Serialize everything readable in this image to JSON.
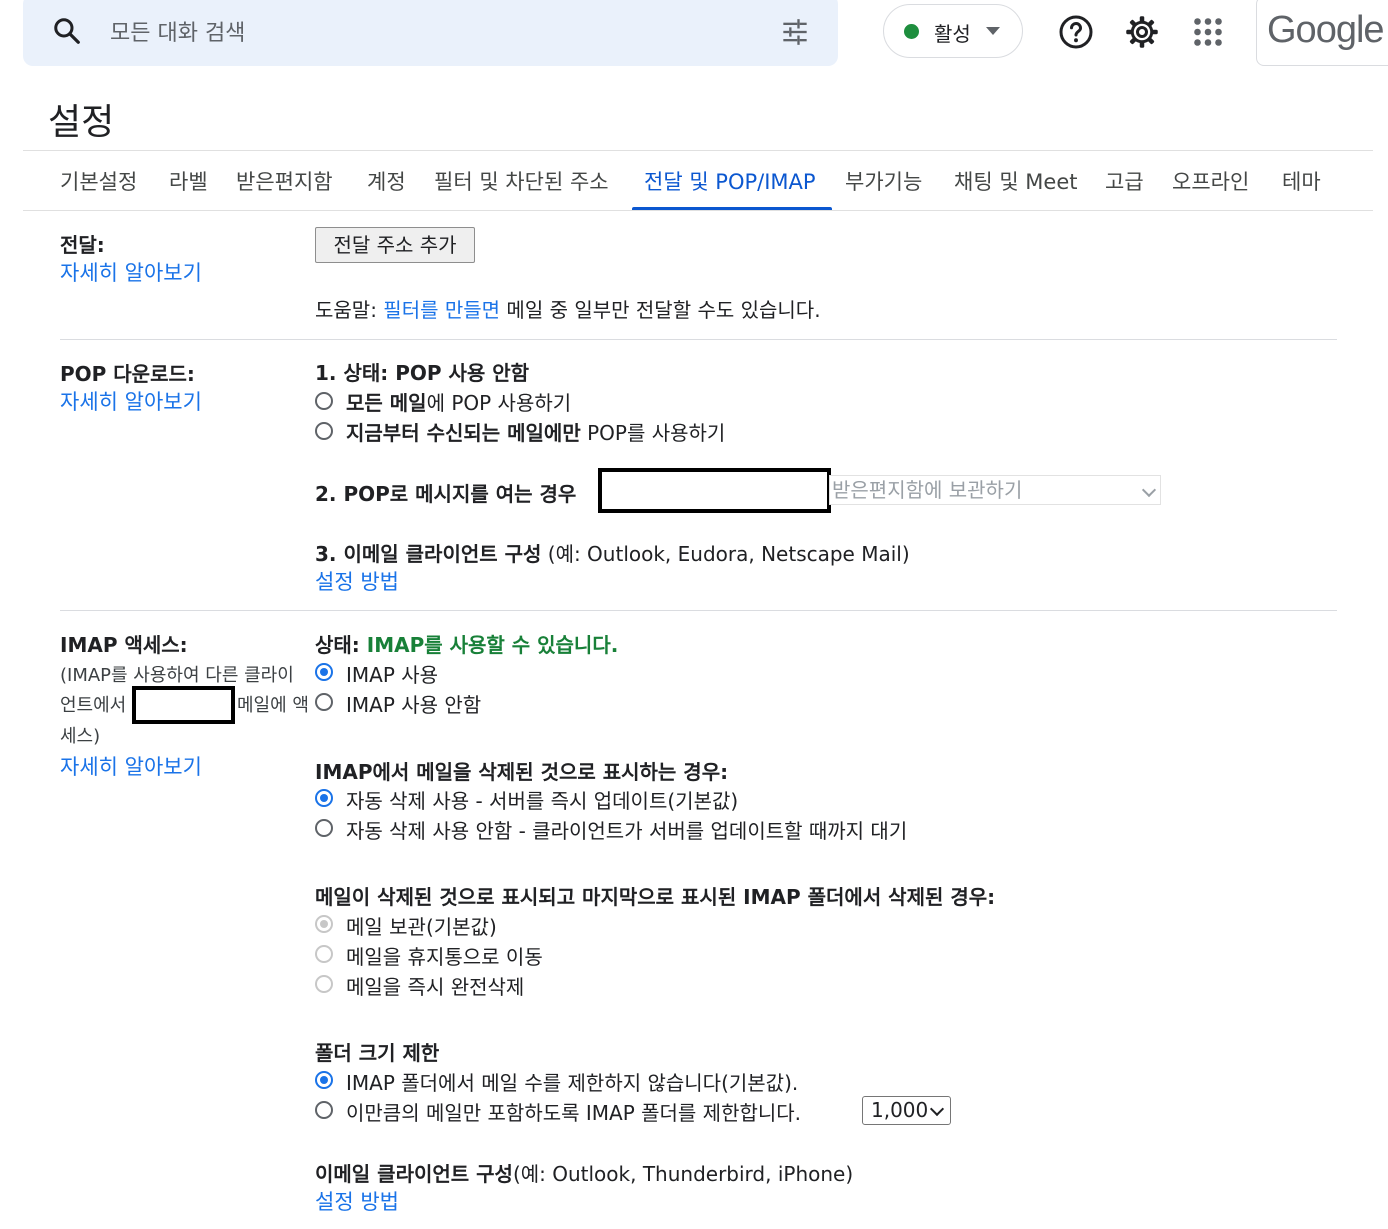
{
  "topbar": {
    "search_placeholder": "모든 대화 검색",
    "status_label": "활성",
    "google_logo": "Google",
    "icons": [
      "search-icon",
      "tune-icon",
      "help-icon",
      "settings-gear-icon",
      "apps-grid-icon"
    ]
  },
  "page_title": "설정",
  "tabs": [
    "기본설정",
    "라벨",
    "받은편지함",
    "계정",
    "필터 및 차단된 주소",
    "전달 및 POP/IMAP",
    "부가기능",
    "채팅 및 Meet",
    "고급",
    "오프라인",
    "테마"
  ],
  "active_tab": "전달 및 POP/IMAP",
  "forwarding": {
    "label": "전달:",
    "learn_more": "자세히 알아보기",
    "add_button": "전달 주소 추가",
    "tip_prefix": "도움말: ",
    "tip_link": "필터를 만들면",
    "tip_suffix": " 메일 중 일부만 전달할 수도 있습니다."
  },
  "pop": {
    "label": "POP 다운로드:",
    "learn_more": "자세히 알아보기",
    "status": "1. 상태: POP 사용 안함",
    "option1_bold": "모든 메일",
    "option1_rest": "에 POP 사용하기",
    "option2_bold": "지금부터 수신되는 메일에만",
    "option2_rest": " POP를 사용하기",
    "when_opened_label": "2. POP로 메시지를 여는 경우",
    "when_opened_value": "받은편지함에 보관하기",
    "client_bold": "3. 이메일 클라이언트 구성",
    "client_rest": " (예: Outlook, Eudora, Netscape Mail)",
    "setup_link": "설정 방법"
  },
  "imap": {
    "label": "IMAP 액세스:",
    "desc_line1": "(IMAP를 사용하여 다른 클라이",
    "desc_line2a": "언트에서",
    "desc_line2b": "메일에 액",
    "desc_line3": "세스)",
    "learn_more": "자세히 알아보기",
    "status_prefix": "상태: ",
    "status_value": "IMAP를 사용할 수 있습니다.",
    "enable": "IMAP 사용",
    "disable": "IMAP 사용 안함",
    "delete_heading": "IMAP에서 메일을 삭제된 것으로 표시하는 경우:",
    "auto_expunge_on": "자동 삭제 사용 - 서버를 즉시 업데이트(기본값)",
    "auto_expunge_off": "자동 삭제 사용 안함 - 클라이언트가 서버를 업데이트할 때까지 대기",
    "expunge_heading": "메일이 삭제된 것으로 표시되고 마지막으로 표시된 IMAP 폴더에서 삭제된 경우:",
    "archive": "메일 보관(기본값)",
    "trash": "메일을 휴지통으로 이동",
    "delete_forever": "메일을 즉시 완전삭제",
    "folder_heading": "폴더 크기 제한",
    "no_limit": "IMAP 폴더에서 메일 수를 제한하지 않습니다(기본값).",
    "limit": "이만큼의 메일만 포함하도록 IMAP 폴더를 제한합니다.",
    "limit_value": "1,000",
    "client_bold": "이메일 클라이언트 구성",
    "client_rest": "(예: Outlook, Thunderbird, iPhone)",
    "setup_link": "설정 방법"
  }
}
